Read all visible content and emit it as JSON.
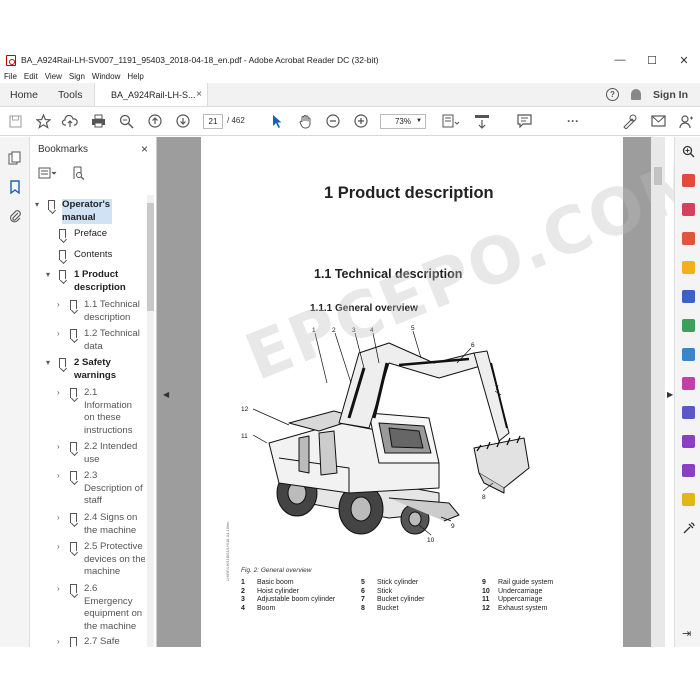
{
  "window": {
    "title": "BA_A924Rail-LH-SV007_1191_95403_2018-04-18_en.pdf - Adobe Acrobat Reader DC (32-bit)",
    "controls": [
      "—",
      "☐",
      "✕"
    ]
  },
  "menu": [
    "File",
    "Edit",
    "View",
    "Sign",
    "Window",
    "Help"
  ],
  "tabs": {
    "home": "Home",
    "tools": "Tools",
    "document": "BA_A924Rail-LH-S...",
    "close": "×",
    "sign_in": "Sign In",
    "help": "?"
  },
  "toolbar": {
    "current_page": "21",
    "total_pages": "/ 462",
    "zoom": "73%"
  },
  "bookmarks": {
    "title": "Bookmarks",
    "close": "×",
    "items": [
      {
        "text": "Operator's manual",
        "level": 0,
        "expanded": true,
        "selected": true
      },
      {
        "text": "Preface",
        "level": 1
      },
      {
        "text": "Contents",
        "level": 1
      },
      {
        "text": "1 Product description",
        "level": 1,
        "expanded": true,
        "bold": true
      },
      {
        "text": "1.1 Technical description",
        "level": 2,
        "collapsed": true
      },
      {
        "text": "1.2 Technical data",
        "level": 2,
        "collapsed": true
      },
      {
        "text": "2 Safety warnings",
        "level": 1,
        "expanded": true,
        "bold": true
      },
      {
        "text": "2.1 Information on these instructions",
        "level": 2,
        "collapsed": true
      },
      {
        "text": "2.2 Intended use",
        "level": 2,
        "collapsed": true
      },
      {
        "text": "2.3 Description of staff",
        "level": 2,
        "collapsed": true
      },
      {
        "text": "2.4 Signs on the machine",
        "level": 2,
        "collapsed": true
      },
      {
        "text": "2.5 Protective devices on the machine",
        "level": 2,
        "collapsed": true
      },
      {
        "text": "2.6 Emergency equipment on the machine",
        "level": 2,
        "collapsed": true
      },
      {
        "text": "2.7 Safe",
        "level": 2,
        "collapsed": true
      }
    ]
  },
  "document": {
    "heading1": "1  Product description",
    "heading2": "1.1   Technical description",
    "heading3": "1.1.1   General overview",
    "figure_caption": "Fig. 2: General overview",
    "side_code": "LH/BF/LH/118/01/LH/18-04-18/en",
    "watermark": "EPCEPO.COM",
    "callouts": [
      "1",
      "2",
      "3",
      "4",
      "5",
      "6",
      "7",
      "8",
      "9",
      "10",
      "11",
      "12"
    ],
    "legend": [
      [
        {
          "n": "1",
          "t": "Basic boom"
        },
        {
          "n": "2",
          "t": "Hoist cylinder"
        },
        {
          "n": "3",
          "t": "Adjustable boom cylinder"
        },
        {
          "n": "4",
          "t": "Boom"
        }
      ],
      [
        {
          "n": "5",
          "t": "Stick cylinder"
        },
        {
          "n": "6",
          "t": "Stick"
        },
        {
          "n": "7",
          "t": "Bucket cylinder"
        },
        {
          "n": "8",
          "t": "Bucket"
        }
      ],
      [
        {
          "n": "9",
          "t": "Rail guide system"
        },
        {
          "n": "10",
          "t": "Undercarriage"
        },
        {
          "n": "11",
          "t": "Uppercarriage"
        },
        {
          "n": "12",
          "t": "Exhaust system"
        }
      ]
    ]
  }
}
